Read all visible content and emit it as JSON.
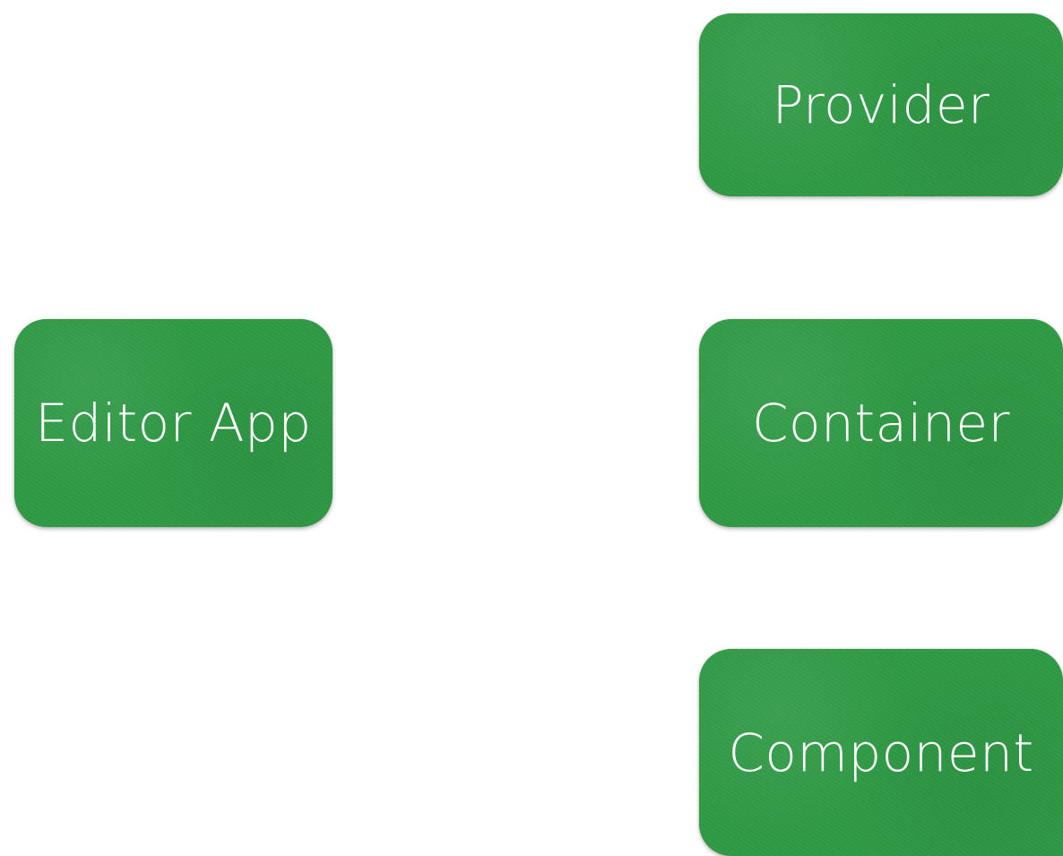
{
  "nodes": {
    "editor_app": {
      "label": "Editor App"
    },
    "provider": {
      "label": "Provider"
    },
    "container": {
      "label": "Container"
    },
    "component": {
      "label": "Component"
    }
  },
  "colors": {
    "node_fill": "#2f9a45",
    "node_text": "#ffffff",
    "background": "#ffffff"
  }
}
